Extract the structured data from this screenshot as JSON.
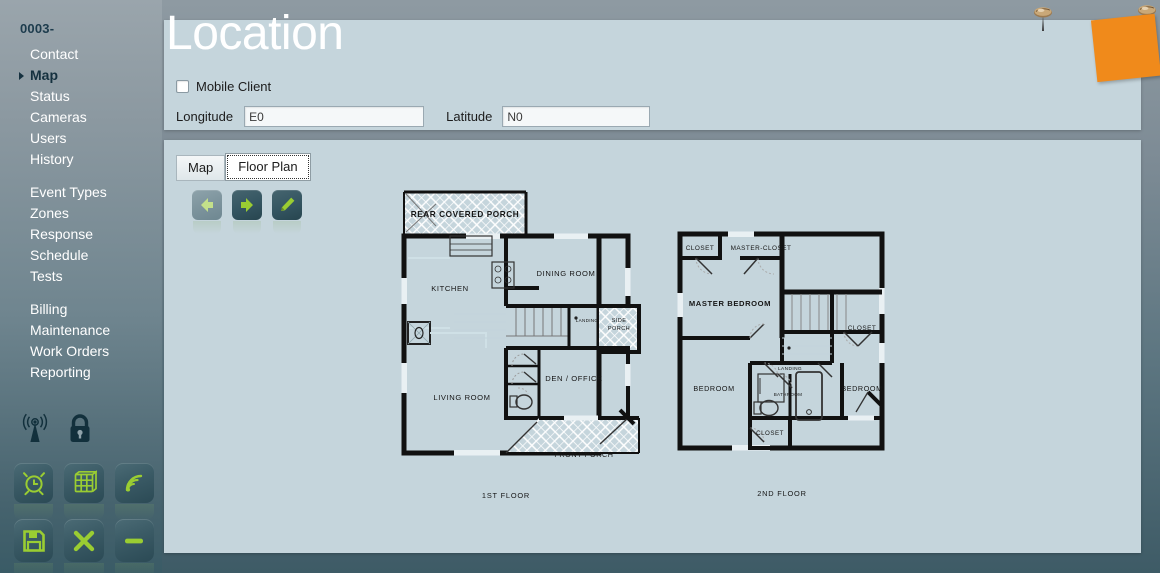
{
  "sidebar": {
    "code": "0003-",
    "items": [
      {
        "label": "Contact",
        "active": false,
        "name": "contact"
      },
      {
        "label": "Map",
        "active": true,
        "name": "map"
      },
      {
        "label": "Status",
        "active": false,
        "name": "status"
      },
      {
        "label": "Cameras",
        "active": false,
        "name": "cameras"
      },
      {
        "label": "Users",
        "active": false,
        "name": "users"
      },
      {
        "label": "History",
        "active": false,
        "name": "history"
      },
      {
        "label": "Event Types",
        "active": false,
        "name": "event-types",
        "gap_before": true
      },
      {
        "label": "Zones",
        "active": false,
        "name": "zones"
      },
      {
        "label": "Response",
        "active": false,
        "name": "response"
      },
      {
        "label": "Schedule",
        "active": false,
        "name": "schedule"
      },
      {
        "label": "Tests",
        "active": false,
        "name": "tests"
      },
      {
        "label": "Billing",
        "active": false,
        "name": "billing",
        "gap_before": true
      },
      {
        "label": "Maintenance",
        "active": false,
        "name": "maintenance"
      },
      {
        "label": "Work Orders",
        "active": false,
        "name": "work-orders"
      },
      {
        "label": "Reporting",
        "active": false,
        "name": "reporting"
      }
    ],
    "icons": {
      "plain": [
        "antenna-icon",
        "lock-icon"
      ],
      "tiles_row1": [
        "alarm-clock-icon",
        "globe-grid-icon",
        "wireless-signal-icon"
      ],
      "tiles_row2": [
        "save-icon",
        "close-icon",
        "minus-icon"
      ]
    },
    "accent_color": "#9acd32",
    "active_color": "#15313f"
  },
  "header": {
    "title": "Location",
    "mobile_client_label": "Mobile Client",
    "mobile_client_checked": false,
    "longitude_label": "Longitude",
    "longitude_value": "E0",
    "latitude_label": "Latitude",
    "latitude_value": "N0"
  },
  "body": {
    "tabs": [
      {
        "label": "Map",
        "active": false,
        "name": "map"
      },
      {
        "label": "Floor Plan",
        "active": true,
        "name": "floor-plan"
      }
    ],
    "nav_buttons": [
      {
        "name": "previous-button",
        "icon": "arrow-left-icon",
        "enabled": false
      },
      {
        "name": "next-button",
        "icon": "arrow-right-icon",
        "enabled": true
      },
      {
        "name": "edit-button",
        "icon": "pencil-icon",
        "enabled": true
      }
    ]
  },
  "floor_plan": {
    "floor1_caption": "1ST FLOOR",
    "floor2_caption": "2ND FLOOR",
    "floor1_rooms": [
      "REAR COVERED PORCH",
      "KITCHEN",
      "DINING ROOM",
      "SIDE PORCH",
      "LANDING",
      "LIVING ROOM",
      "DEN / OFFICE",
      "FRONT PORCH"
    ],
    "floor2_rooms": [
      "CLOSET",
      "CLOSET",
      "MASTER BEDROOM",
      "CLOSET",
      "LANDING",
      "BEDROOM",
      "BATHROOM",
      "BEDROOM",
      "CLOSET"
    ]
  },
  "decorations": {
    "sticky_note_color": "#f08a1b",
    "pin_color": "#8a6a46",
    "pins": [
      "pushpin-left",
      "pushpin-right"
    ]
  }
}
